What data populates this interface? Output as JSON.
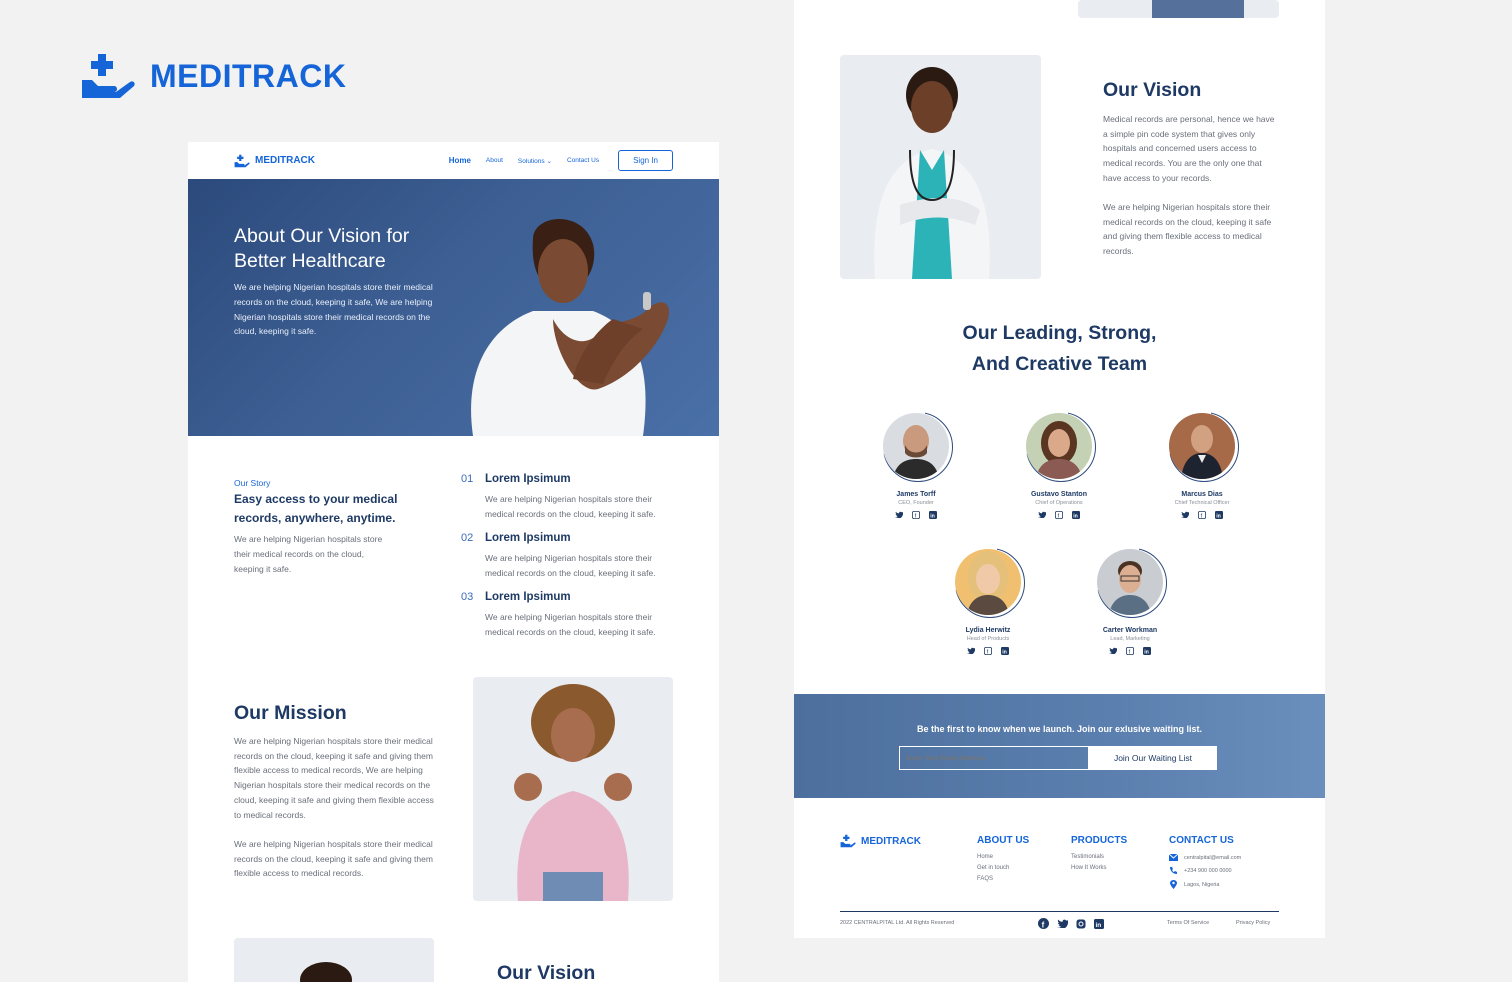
{
  "brand": {
    "name": "MEDITRACK"
  },
  "nav": {
    "logo": "MEDITRACK",
    "links": [
      "Home",
      "About",
      "Solutions",
      "Contact Us"
    ],
    "signin": "Sign In"
  },
  "hero": {
    "title": "About Our Vision for Better Healthcare",
    "text": "We are helping Nigerian hospitals store their medical records on the cloud, keeping it safe, We are helping Nigerian hospitals store their medical records on the cloud, keeping it safe."
  },
  "story": {
    "label": "Our Story",
    "title": "Easy access to your medical records, anywhere, anytime.",
    "text": "We are helping Nigerian hospitals store their medical records on the cloud, keeping it safe.",
    "items": [
      {
        "num": "01",
        "title": "Lorem Ipsimum",
        "text": "We are helping Nigerian hospitals store their medical records on the cloud, keeping it safe."
      },
      {
        "num": "02",
        "title": "Lorem Ipsimum",
        "text": "We are helping Nigerian hospitals store their medical records on the cloud, keeping it safe."
      },
      {
        "num": "03",
        "title": "Lorem Ipsimum",
        "text": "We are helping Nigerian hospitals store their medical records on the cloud, keeping it safe."
      }
    ]
  },
  "mission": {
    "title": "Our Mission",
    "p1": "We are helping Nigerian hospitals store their medical records on the cloud, keeping it safe and giving them flexible access to medical records, We are helping Nigerian hospitals store their medical records on the cloud, keeping it safe and giving them flexible access to medical records.",
    "p2": "We are helping Nigerian hospitals store their medical records on the cloud, keeping it safe and giving them flexible access to medical records."
  },
  "vision": {
    "title": "Our Vision",
    "p1": "Medical records are personal, hence we have a simple pin code system that gives only hospitals and concerned users access to medical records. You are the only one that have access to your records.",
    "p2": "We are helping Nigerian hospitals store their medical records on the cloud, keeping it safe and giving them flexible access to medical records."
  },
  "team": {
    "title_line1": "Our Leading, Strong,",
    "title_line2": "And Creative Team",
    "members": [
      {
        "name": "James Torff",
        "role": "CEO, Founder"
      },
      {
        "name": "Gustavo Stanton",
        "role": "Chief of Operations"
      },
      {
        "name": "Marcus Dias",
        "role": "Chief Technical Officer"
      },
      {
        "name": "Lydia Herwitz",
        "role": "Head of Products"
      },
      {
        "name": "Carter Workman",
        "role": "Lead, Marketing"
      }
    ]
  },
  "waitlist": {
    "text": "Be the first to know when we launch. Join our exlusive waiting list.",
    "placeholder": "Enter Your Email Address",
    "button": "Join Our Waiting List"
  },
  "footer": {
    "logo": "MEDITRACK",
    "about": {
      "heading": "ABOUT US",
      "links": [
        "Home",
        "Get in touch",
        "FAQS"
      ]
    },
    "products": {
      "heading": "PRODUCTS",
      "links": [
        "Testimonials",
        "How It Works"
      ]
    },
    "contact": {
      "heading": "CONTACT US",
      "email": "centralpital@email.com",
      "phone": "+234 900 000 0000",
      "location": "Lagos, Nigeria"
    },
    "copyright": "2022 CENTRALPITAL Ltd. All Rights Reserved",
    "terms": "Terms Of Service",
    "privacy": "Privacy Policy"
  },
  "colors": {
    "accent": "#1565d8",
    "navy": "#1e3a64",
    "hero": "#3d5f93"
  }
}
